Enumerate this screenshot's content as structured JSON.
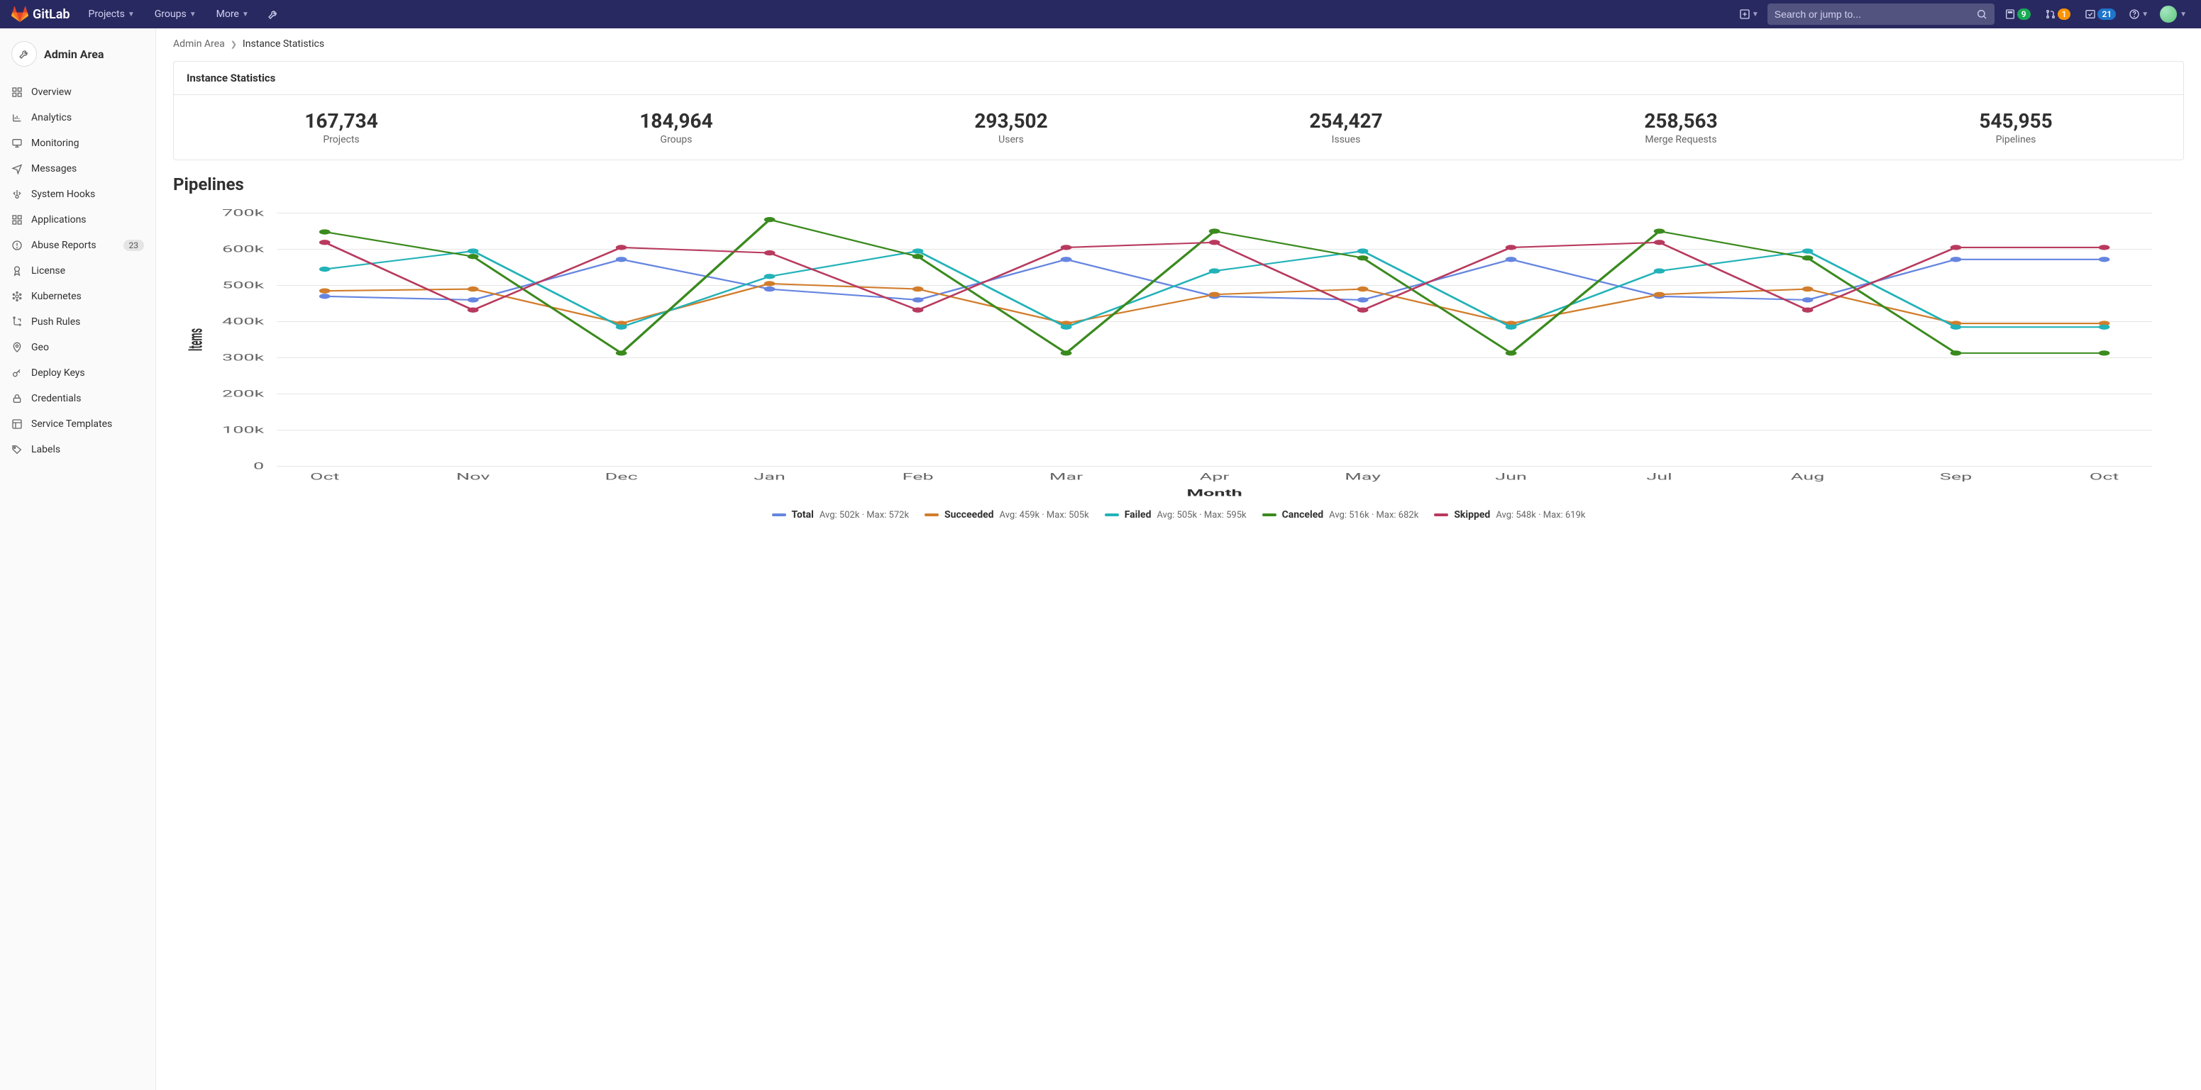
{
  "header": {
    "brand": "GitLab",
    "nav": [
      {
        "label": "Projects",
        "has_dropdown": true
      },
      {
        "label": "Groups",
        "has_dropdown": true
      },
      {
        "label": "More",
        "has_dropdown": true
      }
    ],
    "search_placeholder": "Search or jump to...",
    "counters": {
      "issues": "9",
      "merge_requests": "1",
      "todos": "21"
    }
  },
  "sidebar": {
    "title": "Admin Area",
    "items": [
      {
        "icon": "dashboard",
        "label": "Overview"
      },
      {
        "icon": "analytics",
        "label": "Analytics"
      },
      {
        "icon": "monitor",
        "label": "Monitoring"
      },
      {
        "icon": "messages",
        "label": "Messages"
      },
      {
        "icon": "hooks",
        "label": "System Hooks"
      },
      {
        "icon": "applications",
        "label": "Applications"
      },
      {
        "icon": "abuse",
        "label": "Abuse Reports",
        "badge": "23"
      },
      {
        "icon": "license",
        "label": "License"
      },
      {
        "icon": "kubernetes",
        "label": "Kubernetes"
      },
      {
        "icon": "push-rules",
        "label": "Push Rules"
      },
      {
        "icon": "geo",
        "label": "Geo"
      },
      {
        "icon": "key",
        "label": "Deploy Keys"
      },
      {
        "icon": "lock",
        "label": "Credentials"
      },
      {
        "icon": "template",
        "label": "Service Templates"
      },
      {
        "icon": "labels",
        "label": "Labels"
      }
    ]
  },
  "breadcrumb": {
    "root": "Admin Area",
    "current": "Instance Statistics"
  },
  "panel": {
    "title": "Instance Statistics",
    "stats": [
      {
        "value": "167,734",
        "label": "Projects"
      },
      {
        "value": "184,964",
        "label": "Groups"
      },
      {
        "value": "293,502",
        "label": "Users"
      },
      {
        "value": "254,427",
        "label": "Issues"
      },
      {
        "value": "258,563",
        "label": "Merge Requests"
      },
      {
        "value": "545,955",
        "label": "Pipelines"
      }
    ]
  },
  "chart_section_title": "Pipelines",
  "chart_data": {
    "type": "line",
    "title": "Pipelines",
    "xlabel": "Month",
    "ylabel": "Items",
    "ylim": [
      0,
      700000
    ],
    "y_ticks": [
      0,
      100000,
      200000,
      300000,
      400000,
      500000,
      600000,
      700000
    ],
    "y_tick_labels": [
      "0",
      "100k",
      "200k",
      "300k",
      "400k",
      "500k",
      "600k",
      "700k"
    ],
    "categories": [
      "Oct",
      "Nov",
      "Dec",
      "Jan",
      "Feb",
      "Mar",
      "Apr",
      "May",
      "Jun",
      "Jul",
      "Aug",
      "Sep",
      "Oct"
    ],
    "series": [
      {
        "name": "Total",
        "color": "#6585e0",
        "avg": "502k",
        "max": "572k",
        "values": [
          470000,
          460000,
          572000,
          490000,
          460000,
          572000,
          470000,
          460000,
          572000,
          470000,
          460000,
          572000,
          572000
        ]
      },
      {
        "name": "Succeeded",
        "color": "#d17d2c",
        "avg": "459k",
        "max": "505k",
        "values": [
          485000,
          490000,
          395000,
          505000,
          490000,
          395000,
          475000,
          490000,
          395000,
          475000,
          490000,
          395000,
          395000
        ]
      },
      {
        "name": "Failed",
        "color": "#22b2b8",
        "avg": "505k",
        "max": "595k",
        "values": [
          545000,
          595000,
          385000,
          525000,
          595000,
          385000,
          540000,
          595000,
          385000,
          540000,
          595000,
          385000,
          385000
        ]
      },
      {
        "name": "Canceled",
        "color": "#3a8a1e",
        "avg": "516k",
        "max": "682k",
        "values": [
          648000,
          580000,
          313000,
          682000,
          580000,
          313000,
          650000,
          576000,
          313000,
          650000,
          576000,
          313000,
          313000
        ]
      },
      {
        "name": "Skipped",
        "color": "#b83a5e",
        "avg": "548k",
        "max": "619k",
        "values": [
          619000,
          432000,
          605000,
          590000,
          432000,
          605000,
          619000,
          432000,
          605000,
          619000,
          432000,
          605000,
          605000
        ]
      }
    ]
  }
}
